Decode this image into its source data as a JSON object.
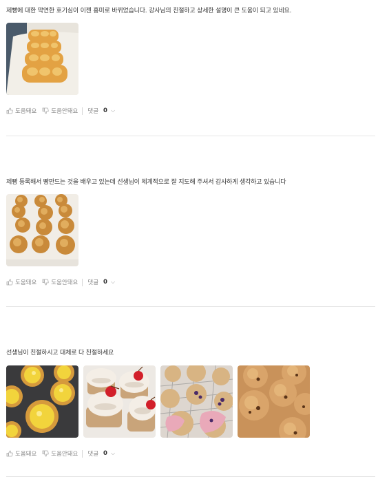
{
  "reviews": [
    {
      "text": "제빵에 대한 막연한 호기심이 이젠 흥미로 바뀌었습니다. 강사님의 친절하고 상세한 설명이 큰 도움이 되고 있네요.",
      "photos": [
        {
          "icon": "bread-loaf-photo"
        }
      ],
      "like_label": "도움돼요",
      "dislike_label": "도움안돼요",
      "comment_label": "댓글",
      "comment_count": "0"
    },
    {
      "text": "제빵 등록해서 빵만드는 것을 배우고 있는데 선생님이 체계적으로 잘 지도해 주셔서 감사하게 생각하고 있습니다",
      "photos": [
        {
          "icon": "streusel-buns-photo"
        }
      ],
      "like_label": "도움돼요",
      "dislike_label": "도움안돼요",
      "comment_label": "댓글",
      "comment_count": "0"
    },
    {
      "text": "선생님이 친절하시고 대체로 다 친절하세요",
      "photos": [
        {
          "icon": "egg-tart-photo"
        },
        {
          "icon": "cherry-cupcake-photo"
        },
        {
          "icon": "berry-scone-photo"
        },
        {
          "icon": "cookie-photo"
        }
      ],
      "like_label": "도움돼요",
      "dislike_label": "도움안돼요",
      "comment_label": "댓글",
      "comment_count": "0"
    }
  ]
}
